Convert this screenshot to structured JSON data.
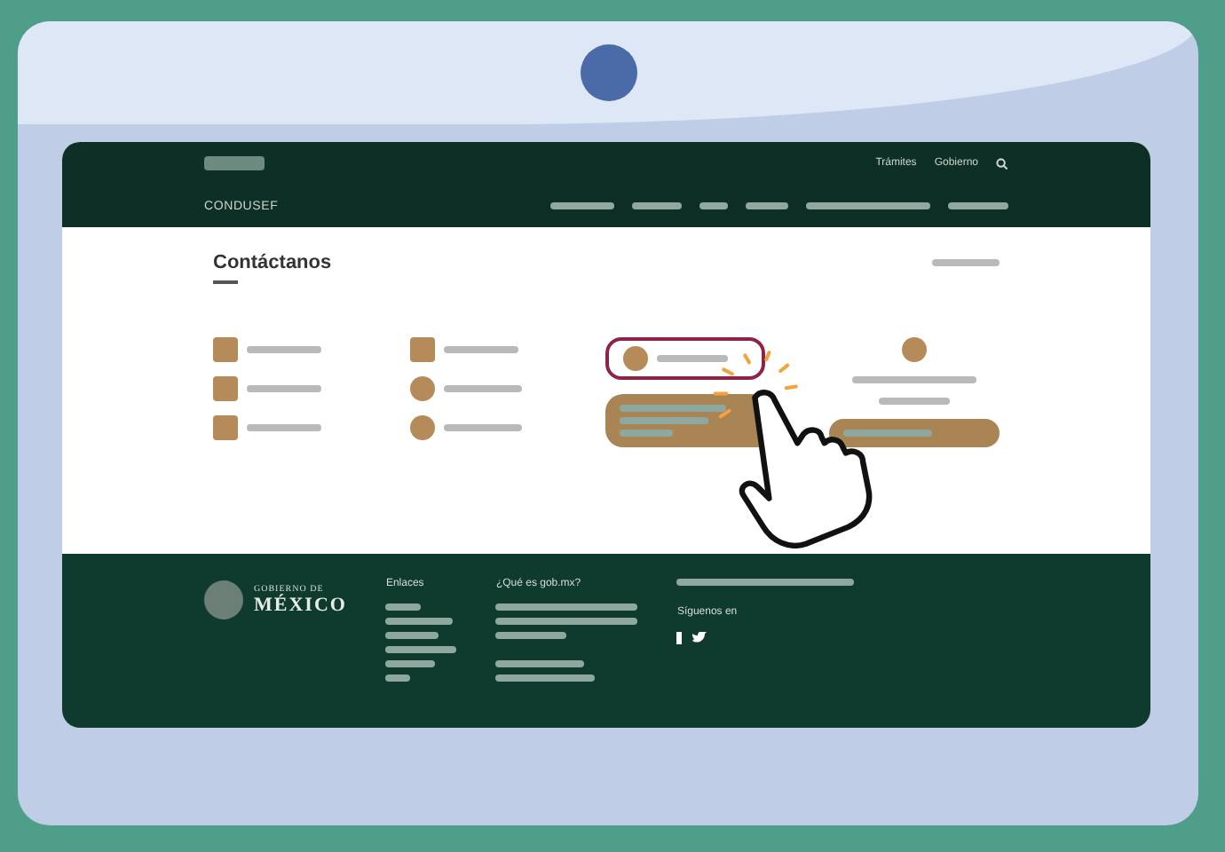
{
  "header": {
    "agency": "CONDUSEF",
    "top_links": [
      "Trámites",
      "Gobierno"
    ]
  },
  "contact": {
    "title": "Contáctanos"
  },
  "footer": {
    "brand_small": "GOBIERNO DE",
    "brand_large": "MÉXICO",
    "links_title": "Enlaces",
    "about_title": "¿Qué es gob.mx?",
    "follow_label": "Síguenos en"
  }
}
